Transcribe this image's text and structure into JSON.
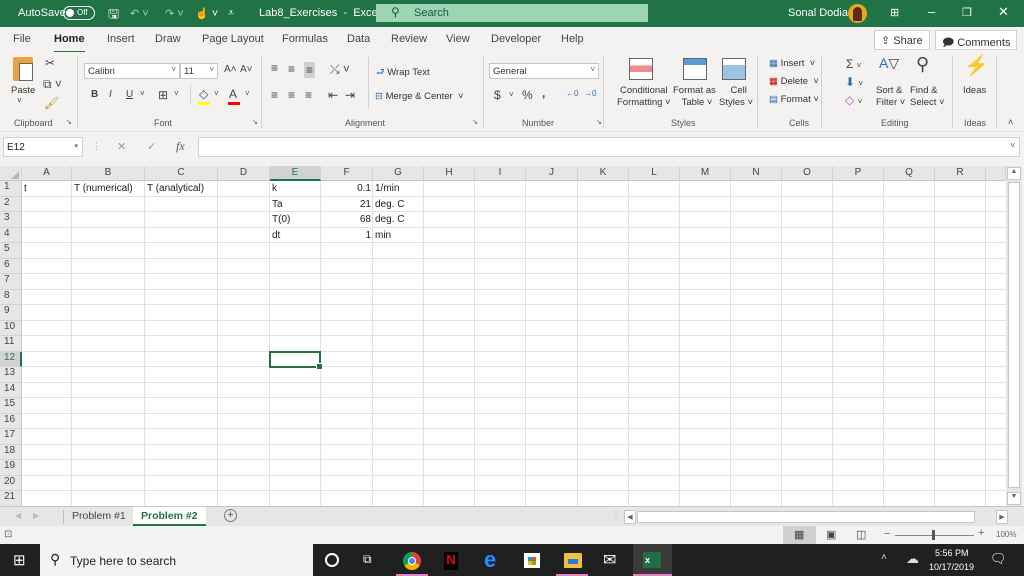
{
  "titlebar": {
    "autosave_label": "AutoSave",
    "autosave_state": "Off",
    "doc_title": "Lab8_Exercises",
    "app_sep": "-",
    "app_name": "Excel",
    "search_placeholder": "Search",
    "user_name": "Sonal Dodia"
  },
  "tabs": [
    "File",
    "Home",
    "Insert",
    "Draw",
    "Page Layout",
    "Formulas",
    "Data",
    "Review",
    "View",
    "Developer",
    "Help"
  ],
  "active_tab": "Home",
  "share_label": "Share",
  "comments_label": "Comments",
  "ribbon": {
    "clipboard": {
      "paste": "Paste",
      "label": "Clipboard"
    },
    "font": {
      "name": "Calibri",
      "size": "11",
      "label": "Font",
      "bold": "B",
      "italic": "I",
      "underline": "U",
      "highlight_color": "#ffff00",
      "font_color": "#ff0000"
    },
    "alignment": {
      "wrap_text": "Wrap Text",
      "merge_center": "Merge & Center",
      "label": "Alignment"
    },
    "number": {
      "format": "General",
      "currency": "$",
      "percent": "%",
      "comma": ",",
      "label": "Number"
    },
    "styles": {
      "conditional": [
        "Conditional",
        "Formatting"
      ],
      "format_table": [
        "Format as",
        "Table"
      ],
      "cell_styles": [
        "Cell",
        "Styles"
      ],
      "label": "Styles"
    },
    "cells": {
      "insert": "Insert",
      "delete": "Delete",
      "format": "Format",
      "label": "Cells"
    },
    "editing": {
      "sort_filter": [
        "Sort &",
        "Filter"
      ],
      "find_select": [
        "Find &",
        "Select"
      ],
      "label": "Editing"
    },
    "ideas": {
      "button": "Ideas",
      "label": "Ideas"
    }
  },
  "formula_bar": {
    "name_box": "E12",
    "fx": "fx",
    "cancel": "✕",
    "enter": "✓",
    "value": ""
  },
  "sheet": {
    "columns": [
      "A",
      "B",
      "C",
      "D",
      "E",
      "F",
      "G",
      "H",
      "I",
      "J",
      "K",
      "L",
      "M",
      "N",
      "O",
      "P",
      "Q",
      "R"
    ],
    "rows": [
      "1",
      "2",
      "3",
      "4",
      "5",
      "6",
      "7",
      "8",
      "9",
      "10",
      "11",
      "12",
      "13",
      "14",
      "15",
      "16",
      "17",
      "18",
      "19",
      "20",
      "21"
    ],
    "selected_cell": "E12",
    "cells": [
      {
        "ref": "A1",
        "value": "t"
      },
      {
        "ref": "B1",
        "value": "T (numerical)"
      },
      {
        "ref": "C1",
        "value": "T (analytical)"
      },
      {
        "ref": "E1",
        "value": "k"
      },
      {
        "ref": "F1",
        "value": "0.1"
      },
      {
        "ref": "G1",
        "value": "1/min"
      },
      {
        "ref": "E2",
        "value": "Ta"
      },
      {
        "ref": "F2",
        "value": "21"
      },
      {
        "ref": "G2",
        "value": "deg. C"
      },
      {
        "ref": "E3",
        "value": "T(0)"
      },
      {
        "ref": "F3",
        "value": "68"
      },
      {
        "ref": "G3",
        "value": "deg. C"
      },
      {
        "ref": "E4",
        "value": "dt"
      },
      {
        "ref": "F4",
        "value": "1"
      },
      {
        "ref": "G4",
        "value": "min"
      }
    ]
  },
  "sheet_tabs": [
    {
      "name": "Problem #1",
      "active": false
    },
    {
      "name": "Problem #2",
      "active": true
    }
  ],
  "status": {
    "zoom": "100%",
    "zoom_minus": "−",
    "zoom_plus": "+"
  },
  "taskbar": {
    "search_placeholder": "Type here to search",
    "time": "5:56 PM",
    "date": "10/17/2019"
  },
  "colors": {
    "excel_green": "#217346",
    "search_green": "#9fd5b7"
  }
}
